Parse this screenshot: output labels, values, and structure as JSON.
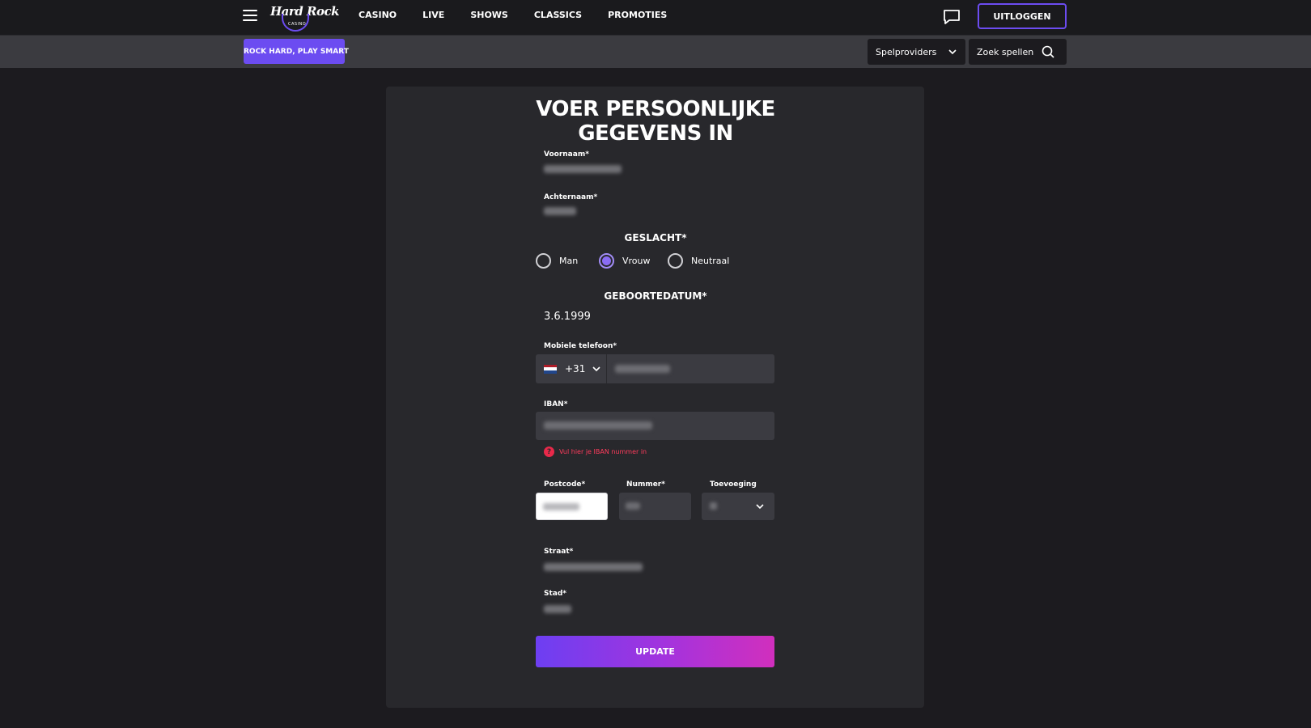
{
  "header": {
    "logo_text": "Hard Rock",
    "logo_sub": "CASINO",
    "nav": [
      "CASINO",
      "LIVE",
      "SHOWS",
      "CLASSICS",
      "PROMOTIES"
    ],
    "logout_label": "UITLOGGEN",
    "brand_color": "#6c4cf1"
  },
  "subbar": {
    "promo_label": "ROCK HARD, PLAY SMART",
    "providers_label": "Spelproviders",
    "search_placeholder": "Zoek spellen"
  },
  "form": {
    "title_line1": "VOER PERSOONLIJKE",
    "title_line2": "GEGEVENS IN",
    "first_name_label": "Voornaam*",
    "last_name_label": "Achternaam*",
    "gender_heading": "GESLACHT*",
    "gender_options": [
      "Man",
      "Vrouw",
      "Neutraal"
    ],
    "gender_selected": "Vrouw",
    "dob_heading": "GEBOORTEDATUM*",
    "dob_value": "3.6.1999",
    "phone_label": "Mobiele telefoon*",
    "phone_code": "+31",
    "iban_label": "IBAN*",
    "iban_error": "Vul hier je IBAN nummer in",
    "postcode_label": "Postcode*",
    "number_label": "Nummer*",
    "addition_label": "Toevoeging",
    "street_label": "Straat*",
    "city_label": "Stad*",
    "update_label": "UPDATE"
  }
}
